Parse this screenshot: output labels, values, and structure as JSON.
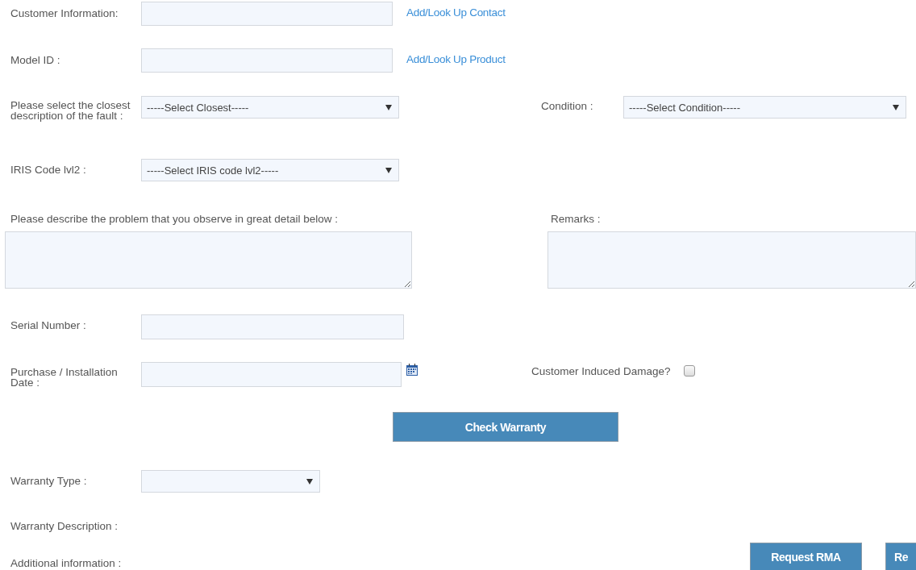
{
  "customer_information": {
    "label": "Customer Information:",
    "link": "Add/Look Up Contact"
  },
  "model_id": {
    "label": "Model ID :",
    "link": "Add/Look Up Product"
  },
  "fault": {
    "label": "Please select the closest description of the fault :",
    "value": "-----Select Closest-----"
  },
  "condition": {
    "label": "Condition :",
    "value": "-----Select Condition-----"
  },
  "iris_code": {
    "label": "IRIS Code lvl2 :",
    "value": "-----Select IRIS code lvl2-----"
  },
  "problem_description": {
    "label": "Please describe the problem that you observe in great detail below :"
  },
  "remarks": {
    "label": "Remarks :"
  },
  "serial_number": {
    "label": "Serial Number :"
  },
  "purchase_date": {
    "label": "Purchase / Installation Date :"
  },
  "customer_induced_damage": {
    "label": "Customer Induced Damage?",
    "checked": false
  },
  "check_warranty_button": "Check Warranty",
  "warranty_type": {
    "label": "Warranty Type :"
  },
  "warranty_description": {
    "label": "Warranty Description :"
  },
  "additional_information": {
    "label": "Additional information :"
  },
  "buttons": [
    "Request RMA",
    "Re"
  ]
}
